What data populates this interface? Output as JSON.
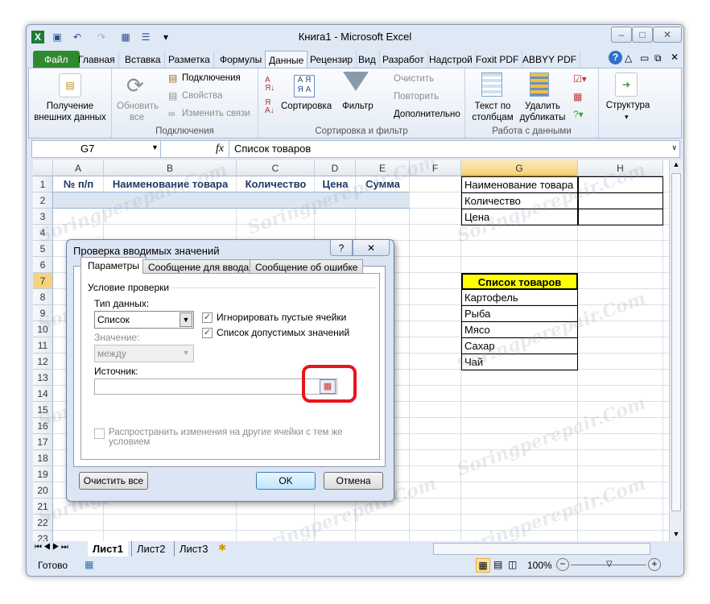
{
  "window": {
    "title": "Книга1  -  Microsoft Excel"
  },
  "ribbon_tabs": [
    "Файл",
    "Главная",
    "Вставка",
    "Разметка",
    "Формулы",
    "Данные",
    "Рецензир",
    "Вид",
    "Разработ",
    "Надстрой",
    "Foxit PDF",
    "ABBYY PDF"
  ],
  "active_tab": "Данные",
  "ribbon": {
    "get_external": "Получение\nвнешних данных",
    "refresh_all": "Обновить\nвсе",
    "connections": "Подключения",
    "properties": "Свойства",
    "edit_links": "Изменить связи",
    "group_connections": "Подключения",
    "sort": "Сортировка",
    "filter": "Фильтр",
    "clear": "Очистить",
    "reapply": "Повторить",
    "advanced": "Дополнительно",
    "group_sort": "Сортировка и фильтр",
    "text_to_columns": "Текст по\nстолбцам",
    "remove_duplicates": "Удалить\nдубликаты",
    "group_data_tools": "Работа с данными",
    "outline": "Структура"
  },
  "formula_bar": {
    "name_box": "G7",
    "fx": "fx",
    "value": "Список товаров"
  },
  "columns": [
    "A",
    "B",
    "C",
    "D",
    "E",
    "F",
    "G",
    "H"
  ],
  "selected_column": "G",
  "selected_row": 7,
  "rows": [
    1,
    2,
    3,
    4,
    5,
    6,
    7,
    8,
    9,
    10,
    11,
    12,
    13,
    14,
    15,
    16,
    17,
    18,
    19,
    20,
    21,
    22,
    23
  ],
  "cells": {
    "A1": "№ п/п",
    "B1": "Наименование товара",
    "C1": "Количество",
    "D1": "Цена",
    "E1": "Сумма",
    "G1": "Наименование товара",
    "G2": "Количество",
    "G3": "Цена",
    "G7": "Список товаров",
    "G8": "Картофель",
    "G9": "Рыба",
    "G10": "Мясо",
    "G11": "Сахар",
    "G12": "Чай"
  },
  "highlight_color": "#ffff00",
  "sheet_tabs": [
    "Лист1",
    "Лист2",
    "Лист3"
  ],
  "active_sheet": "Лист1",
  "status": {
    "ready": "Готово",
    "zoom": "100%"
  },
  "watermark": "Soringperepair.Com",
  "dialog": {
    "title": "Проверка вводимых значений",
    "help": "?",
    "close": "✕",
    "tabs": [
      "Параметры",
      "Сообщение для ввода",
      "Сообщение об ошибке"
    ],
    "section": "Условие проверки",
    "data_type_label": "Тип данных:",
    "data_type_value": "Список",
    "value_label": "Значение:",
    "value_value": "между",
    "ignore_blank": "Игнорировать пустые ячейки",
    "ignore_blank_checked": true,
    "in_cell_dropdown": "Список допустимых значений",
    "in_cell_dropdown_checked": true,
    "source_label": "Источник:",
    "source_value": "",
    "apply_all": "Распространить изменения на другие ячейки с тем же условием",
    "apply_all_checked": false,
    "clear_all": "Очистить все",
    "ok": "OK",
    "cancel": "Отмена",
    "highlight_color": "#e8141b"
  }
}
